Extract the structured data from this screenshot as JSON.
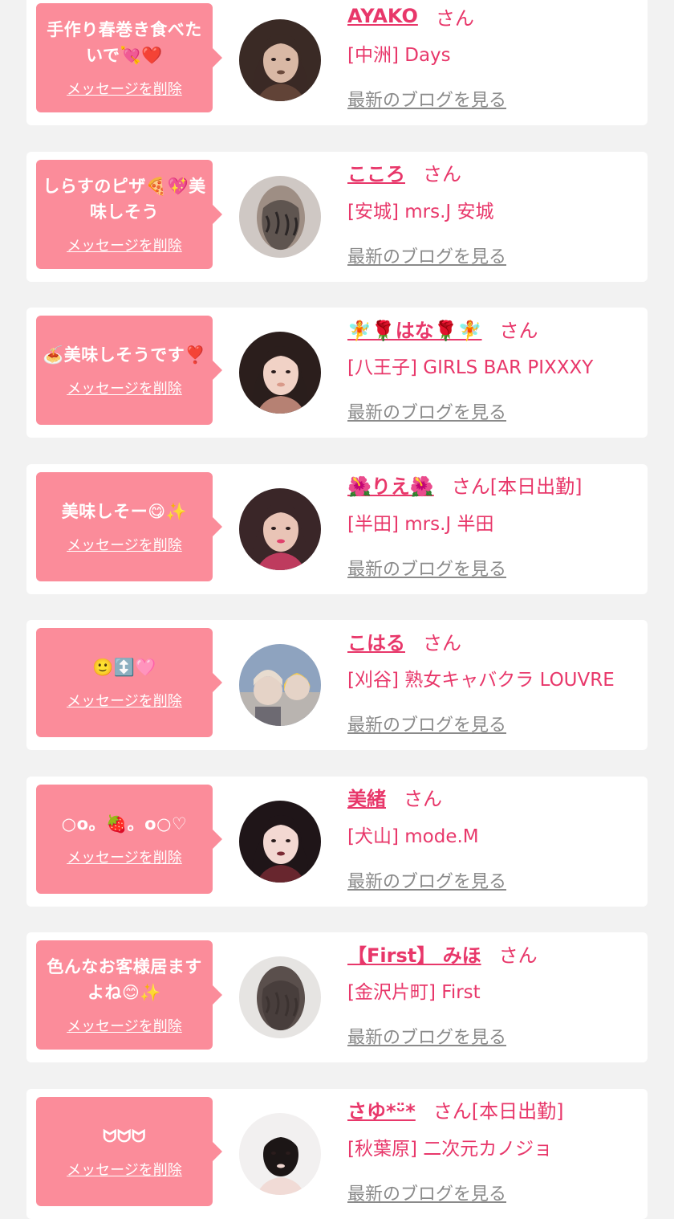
{
  "common": {
    "delete_label": "メッセージを削除",
    "blog_label": "最新のブログを見る"
  },
  "items": [
    {
      "message": "手作り春巻き食べたいで💘❤️",
      "name": "AYAKO",
      "suffix": "さん",
      "shop": "[中洲] Days",
      "avatar_icon": "woman-portrait-photo",
      "avatar_colors": [
        "#3a2a25",
        "#d9b8a5",
        "#6b4a3c"
      ]
    },
    {
      "message": "しらすのピザ🍕💖美味しそう",
      "name": "こころ",
      "suffix": "さん",
      "shop": "[安城] mrs.J 安城",
      "avatar_icon": "braided-hair-back-photo",
      "avatar_colors": [
        "#cfc8c4",
        "#9e8e84",
        "#2b2626"
      ]
    },
    {
      "message": "🍝美味しそうです❣️",
      "name": "🧚🌹はな🌹🧚",
      "suffix": "さん",
      "shop": "[八王子] GIRLS BAR PIXXXY",
      "avatar_icon": "woman-portrait-photo",
      "avatar_colors": [
        "#2b1e1c",
        "#f1d2c6",
        "#d99a8a"
      ]
    },
    {
      "message": "美味しそー😋✨",
      "name": "🌺りえ🌺",
      "suffix": "さん[本日出勤]",
      "shop": "[半田] mrs.J 半田",
      "avatar_icon": "woman-portrait-photo",
      "avatar_colors": [
        "#3a2628",
        "#e9c4b6",
        "#e0416c"
      ]
    },
    {
      "message": "🙂↕️🩷",
      "name": "こはる",
      "suffix": "さん",
      "shop": "[刈谷] 熟女キャバクラ LOUVRE",
      "avatar_icon": "two-women-selfie-photo",
      "avatar_colors": [
        "#8ea3bf",
        "#e5d3c7",
        "#f2c94c"
      ]
    },
    {
      "message": "○o。🍓。o○♡",
      "name": "美緒",
      "suffix": "さん",
      "shop": "[犬山] mode.M",
      "avatar_icon": "woman-portrait-photo",
      "avatar_colors": [
        "#1f1518",
        "#f3d8d2",
        "#7a2a34"
      ]
    },
    {
      "message": "色んなお客様居ますよね😊✨",
      "name": "【First】 みほ",
      "suffix": "さん",
      "shop": "[金沢片町] First",
      "avatar_icon": "curly-hair-back-photo",
      "avatar_colors": [
        "#e6e4e2",
        "#5a4f4c",
        "#3b3230"
      ]
    },
    {
      "message": "ᗢᗢᗢ",
      "name": "さゆ*ᵕ̈*",
      "suffix": "さん[本日出勤]",
      "shop": "[秋葉原] 二次元カノジョ",
      "avatar_icon": "woman-portrait-photo",
      "avatar_colors": [
        "#f2f0f0",
        "#1c1616",
        "#f0d6d0"
      ]
    }
  ]
}
